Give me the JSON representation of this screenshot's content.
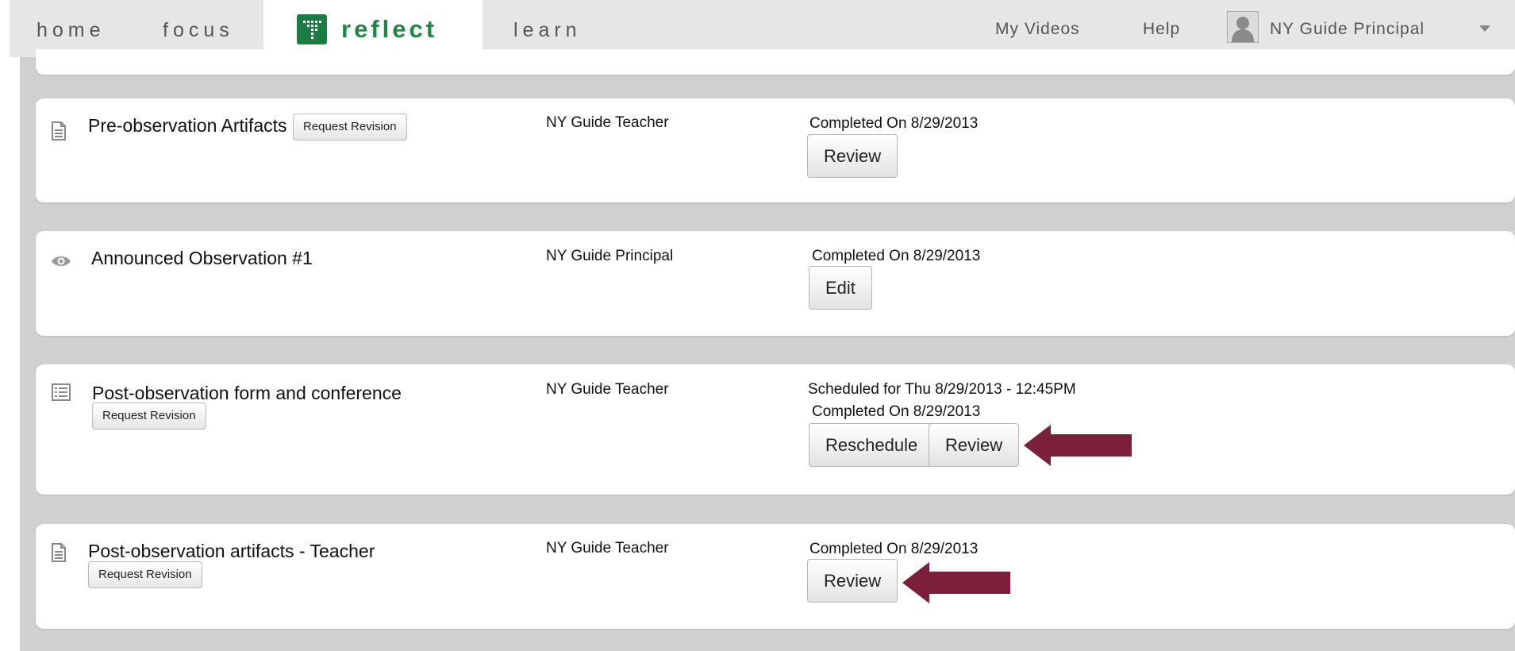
{
  "nav": {
    "home": "home",
    "focus": "focus",
    "reflect": "reflect",
    "learn": "learn",
    "my_videos": "My Videos",
    "help": "Help",
    "user_name": "NY Guide Principal",
    "reflect_brand_color": "#1b8a45"
  },
  "rows": [
    {
      "icon": "document-icon",
      "title": "Pre-observation Artifacts",
      "revision_label": "Request Revision",
      "person": "NY Guide Teacher",
      "status_lines": [
        "Completed On 8/29/2013"
      ],
      "actions": [
        "Review"
      ]
    },
    {
      "icon": "eye-icon",
      "title": "Announced Observation #1",
      "person": "NY Guide Principal",
      "status_lines": [
        "Completed On 8/29/2013"
      ],
      "actions": [
        "Edit"
      ]
    },
    {
      "icon": "form-list-icon",
      "title": "Post-observation form and conference",
      "revision_label": "Request Revision",
      "person": "NY Guide Teacher",
      "status_lines": [
        "Scheduled for Thu 8/29/2013 - 12:45PM",
        "Completed On 8/29/2013"
      ],
      "actions": [
        "Reschedule",
        "Review"
      ]
    },
    {
      "icon": "document-icon",
      "title": "Post-observation artifacts - Teacher",
      "revision_label": "Request Revision",
      "person": "NY Guide Teacher",
      "status_lines": [
        "Completed On 8/29/2013"
      ],
      "actions": [
        "Review"
      ]
    }
  ],
  "annotation_color": "#7b1f3a"
}
